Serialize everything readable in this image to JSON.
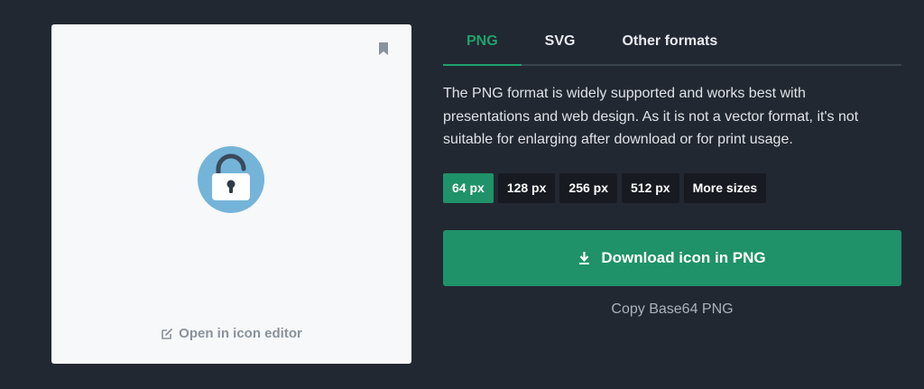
{
  "preview": {
    "editor_link_label": "Open in icon editor",
    "icon_name": "unlocked-padlock-icon",
    "bookmark_icon": "bookmark-icon"
  },
  "tabs": [
    {
      "label": "PNG",
      "active": true
    },
    {
      "label": "SVG",
      "active": false
    },
    {
      "label": "Other formats",
      "active": false
    }
  ],
  "description": "The PNG format is widely supported and works best with presentations and web design. As it is not a vector format, it's not suitable for enlarging after download or for print usage.",
  "sizes": [
    {
      "label": "64 px",
      "selected": true
    },
    {
      "label": "128 px",
      "selected": false
    },
    {
      "label": "256 px",
      "selected": false
    },
    {
      "label": "512 px",
      "selected": false
    },
    {
      "label": "More sizes",
      "selected": false
    }
  ],
  "download_button": {
    "label": "Download icon in PNG",
    "icon": "download-icon"
  },
  "copy_link": "Copy Base64 PNG",
  "colors": {
    "background": "#222831",
    "accent": "#1f9269",
    "card": "#f6f8fa",
    "lock_circle": "#74b4d8"
  }
}
